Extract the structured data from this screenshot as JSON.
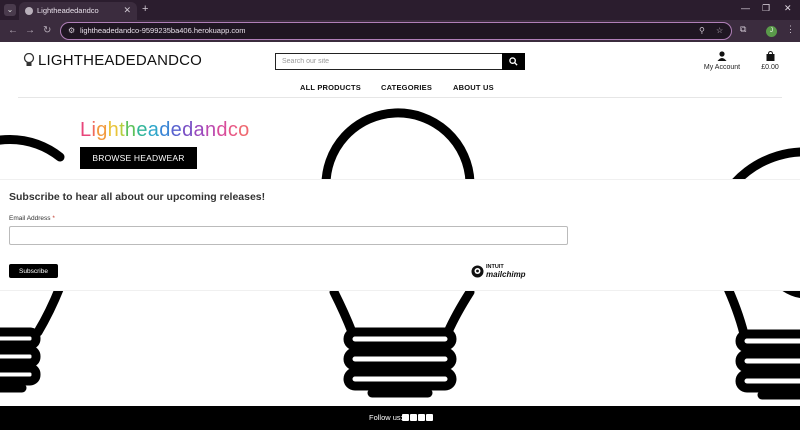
{
  "browser": {
    "tab_title": "Lightheadedandco",
    "url": "lightheadedandco-9599235ba406.herokuapp.com",
    "profile_initial": "J"
  },
  "header": {
    "brand": "LIGHTHEADEDANDCO",
    "search_placeholder": "Search our site",
    "account_label": "My Account",
    "bag_total": "£0.00"
  },
  "nav": {
    "items": [
      "ALL PRODUCTS",
      "CATEGORIES",
      "ABOUT US"
    ]
  },
  "hero": {
    "title_letters": [
      "L",
      "i",
      "g",
      "h",
      "t",
      "h",
      "e",
      "a",
      "d",
      "e",
      "d",
      "a",
      "n",
      "d",
      "c",
      "o"
    ],
    "title_colors": [
      "#e8457a",
      "#f06a5a",
      "#f29a3e",
      "#e9c43a",
      "#b6cf3e",
      "#5cc25a",
      "#33b69a",
      "#2fa6c9",
      "#3b86d6",
      "#5a63cf",
      "#7a4fc4",
      "#9a48bd",
      "#bb4ab0",
      "#d84d9b",
      "#e85a86",
      "#ef6a72"
    ],
    "button_label": "BROWSE HEADWEAR"
  },
  "signup": {
    "heading": "Subscribe to hear all about our upcoming releases!",
    "email_label": "Email Address",
    "required_mark": "*",
    "subscribe_label": "Subscribe",
    "badge_top": "INTUIT",
    "badge_name": "mailchimp"
  },
  "footer": {
    "follow_label": "Follow us:"
  }
}
